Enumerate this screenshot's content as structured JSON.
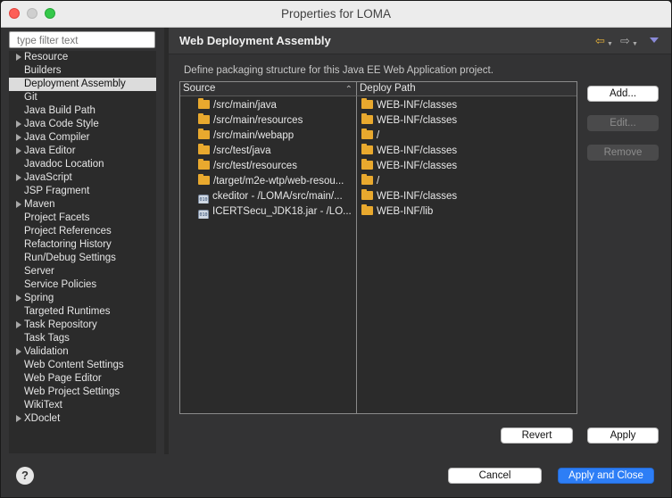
{
  "window": {
    "title": "Properties for LOMA"
  },
  "filter": {
    "placeholder": "type filter text"
  },
  "nav": {
    "items": [
      {
        "label": "Resource",
        "expandable": true,
        "selected": false
      },
      {
        "label": "Builders",
        "expandable": false,
        "selected": false
      },
      {
        "label": "Deployment Assembly",
        "expandable": false,
        "selected": true
      },
      {
        "label": "Git",
        "expandable": false,
        "selected": false
      },
      {
        "label": "Java Build Path",
        "expandable": false,
        "selected": false
      },
      {
        "label": "Java Code Style",
        "expandable": true,
        "selected": false
      },
      {
        "label": "Java Compiler",
        "expandable": true,
        "selected": false
      },
      {
        "label": "Java Editor",
        "expandable": true,
        "selected": false
      },
      {
        "label": "Javadoc Location",
        "expandable": false,
        "selected": false
      },
      {
        "label": "JavaScript",
        "expandable": true,
        "selected": false
      },
      {
        "label": "JSP Fragment",
        "expandable": false,
        "selected": false
      },
      {
        "label": "Maven",
        "expandable": true,
        "selected": false
      },
      {
        "label": "Project Facets",
        "expandable": false,
        "selected": false
      },
      {
        "label": "Project References",
        "expandable": false,
        "selected": false
      },
      {
        "label": "Refactoring History",
        "expandable": false,
        "selected": false
      },
      {
        "label": "Run/Debug Settings",
        "expandable": false,
        "selected": false
      },
      {
        "label": "Server",
        "expandable": false,
        "selected": false
      },
      {
        "label": "Service Policies",
        "expandable": false,
        "selected": false
      },
      {
        "label": "Spring",
        "expandable": true,
        "selected": false
      },
      {
        "label": "Targeted Runtimes",
        "expandable": false,
        "selected": false
      },
      {
        "label": "Task Repository",
        "expandable": true,
        "selected": false
      },
      {
        "label": "Task Tags",
        "expandable": false,
        "selected": false
      },
      {
        "label": "Validation",
        "expandable": true,
        "selected": false
      },
      {
        "label": "Web Content Settings",
        "expandable": false,
        "selected": false
      },
      {
        "label": "Web Page Editor",
        "expandable": false,
        "selected": false
      },
      {
        "label": "Web Project Settings",
        "expandable": false,
        "selected": false
      },
      {
        "label": "WikiText",
        "expandable": false,
        "selected": false
      },
      {
        "label": "XDoclet",
        "expandable": true,
        "selected": false
      }
    ]
  },
  "page": {
    "title": "Web Deployment Assembly",
    "description": "Define packaging structure for this Java EE Web Application project.",
    "header_icons": [
      "back-arrow-icon",
      "forward-arrow-icon",
      "view-menu-icon"
    ]
  },
  "table": {
    "columns": {
      "source": "Source",
      "deploy": "Deploy Path"
    },
    "rows": [
      {
        "source": "/src/main/java",
        "source_icon": "folder-icon",
        "deploy": "WEB-INF/classes"
      },
      {
        "source": "/src/main/resources",
        "source_icon": "folder-icon",
        "deploy": "WEB-INF/classes"
      },
      {
        "source": "/src/main/webapp",
        "source_icon": "folder-icon",
        "deploy": "/"
      },
      {
        "source": "/src/test/java",
        "source_icon": "folder-icon",
        "deploy": "WEB-INF/classes"
      },
      {
        "source": "/src/test/resources",
        "source_icon": "folder-icon",
        "deploy": "WEB-INF/classes"
      },
      {
        "source": "/target/m2e-wtp/web-resou...",
        "source_icon": "folder-icon",
        "deploy": "/"
      },
      {
        "source": "ckeditor - /LOMA/src/main/...",
        "source_icon": "jar-icon",
        "deploy": "WEB-INF/classes"
      },
      {
        "source": "ICERTSecu_JDK18.jar - /LO...",
        "source_icon": "jar-icon",
        "deploy": "WEB-INF/lib"
      }
    ]
  },
  "side_buttons": {
    "add": "Add...",
    "edit": "Edit...",
    "remove": "Remove"
  },
  "page_buttons": {
    "revert": "Revert",
    "apply": "Apply"
  },
  "footer": {
    "cancel": "Cancel",
    "apply_close": "Apply and Close",
    "help": "?"
  },
  "colors": {
    "accent": "#2d7ef6",
    "folder": "#e9a92e",
    "selection": "#dcdcdc",
    "background": "#333334"
  }
}
